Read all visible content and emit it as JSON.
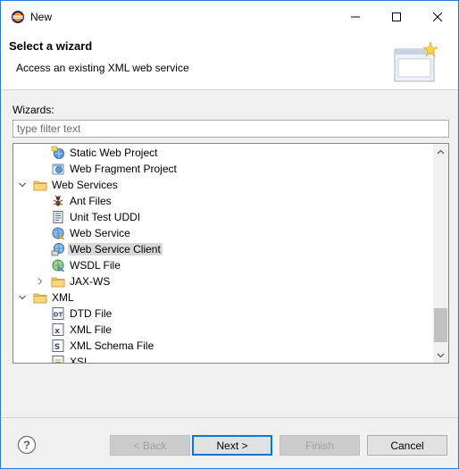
{
  "window": {
    "title": "New",
    "icon": "eclipse-icon"
  },
  "header": {
    "title": "Select a wizard",
    "description": "Access an existing XML web service"
  },
  "wizards_label": "Wizards:",
  "filter": {
    "placeholder": "type filter text",
    "value": ""
  },
  "tree": {
    "items": [
      {
        "label": "Static Web Project",
        "icon": "web-project-icon",
        "level": 2,
        "expander": "none"
      },
      {
        "label": "Web Fragment Project",
        "icon": "web-fragment-icon",
        "level": 2,
        "expander": "none"
      },
      {
        "label": "Web Services",
        "icon": "folder-icon",
        "level": 1,
        "expander": "expanded"
      },
      {
        "label": "Ant Files",
        "icon": "ant-icon",
        "level": 2,
        "expander": "none"
      },
      {
        "label": "Unit Test UDDI",
        "icon": "uddi-icon",
        "level": 2,
        "expander": "none"
      },
      {
        "label": "Web Service",
        "icon": "web-service-icon",
        "level": 2,
        "expander": "none"
      },
      {
        "label": "Web Service Client",
        "icon": "web-service-client-icon",
        "level": 2,
        "expander": "none",
        "selected": true
      },
      {
        "label": "WSDL File",
        "icon": "wsdl-icon",
        "level": 2,
        "expander": "none"
      },
      {
        "label": "JAX-WS",
        "icon": "folder-icon",
        "level": 2,
        "expander": "collapsed"
      },
      {
        "label": "XML",
        "icon": "folder-icon",
        "level": 1,
        "expander": "expanded"
      },
      {
        "label": "DTD File",
        "icon": "dtd-icon",
        "level": 2,
        "expander": "none"
      },
      {
        "label": "XML File",
        "icon": "xml-file-icon",
        "level": 2,
        "expander": "none"
      },
      {
        "label": "XML Schema File",
        "icon": "xml-schema-icon",
        "level": 2,
        "expander": "none"
      },
      {
        "label": "XSL",
        "icon": "xsl-icon",
        "level": 2,
        "expander": "none"
      }
    ]
  },
  "buttons": {
    "back": "< Back",
    "next": "Next >",
    "finish": "Finish",
    "cancel": "Cancel"
  },
  "colors": {
    "window_border": "#2b74d8",
    "selection": "#d9d9d9",
    "default_button_border": "#0078d7"
  }
}
